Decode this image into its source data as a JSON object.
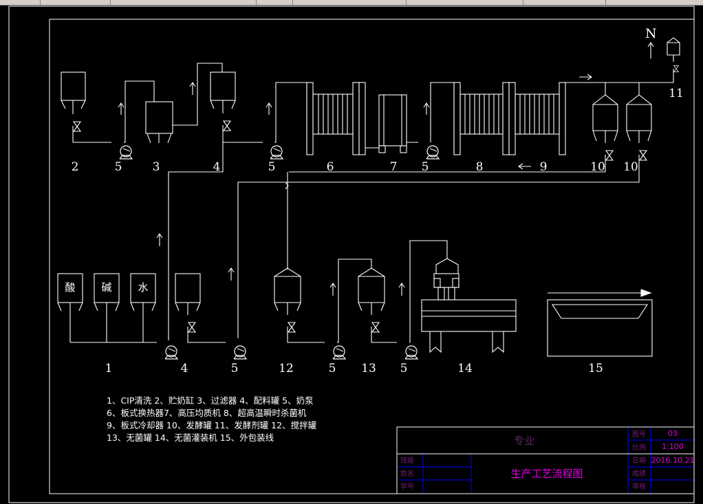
{
  "diagram": {
    "labels": {
      "eq_2": "2",
      "eq_5a": "5",
      "eq_3": "3",
      "eq_4a": "4",
      "eq_5b": "5",
      "eq_6": "6",
      "eq_7": "7",
      "eq_5c": "5",
      "eq_8": "8",
      "eq_9": "9",
      "eq_10a": "10",
      "eq_10b": "10",
      "eq_11": "11",
      "north": "N",
      "eq_1": "1",
      "eq_4b": "4",
      "eq_5d": "5",
      "eq_12": "12",
      "eq_5e": "5",
      "eq_13": "13",
      "eq_5f": "5",
      "eq_14": "14",
      "eq_15": "15"
    },
    "tanks": {
      "acid": "酸",
      "alkali": "碱",
      "water": "水"
    }
  },
  "legend": [
    "1、CIP清洗 2、贮奶缸 3、过滤器 4、配料罐 5、奶泵",
    "6、板式换热器7、高压均质机 8、超高温瞬时杀菌机",
    "9、板式冷却器 10、发酵罐 11、发酵剂罐 12、搅拌罐",
    "13、无菌罐 14、无菌灌装机 15、外包装线"
  ],
  "title_block": {
    "major": "专业",
    "drawing_no_label": "图号",
    "drawing_no": "03",
    "scale_label": "比例",
    "scale": "1:100",
    "class_label": "班级",
    "date_label": "日期",
    "date": "2016.10.21",
    "name_label": "姓名",
    "grade_label": "成绩",
    "student_no_label": "学号",
    "reviewer_label": "审核",
    "title": "生产工艺流程图"
  },
  "colors": {
    "background": "#000000",
    "line": "#ffffff",
    "title_block_border": "#0000ff",
    "title_text": "#e000e0"
  }
}
